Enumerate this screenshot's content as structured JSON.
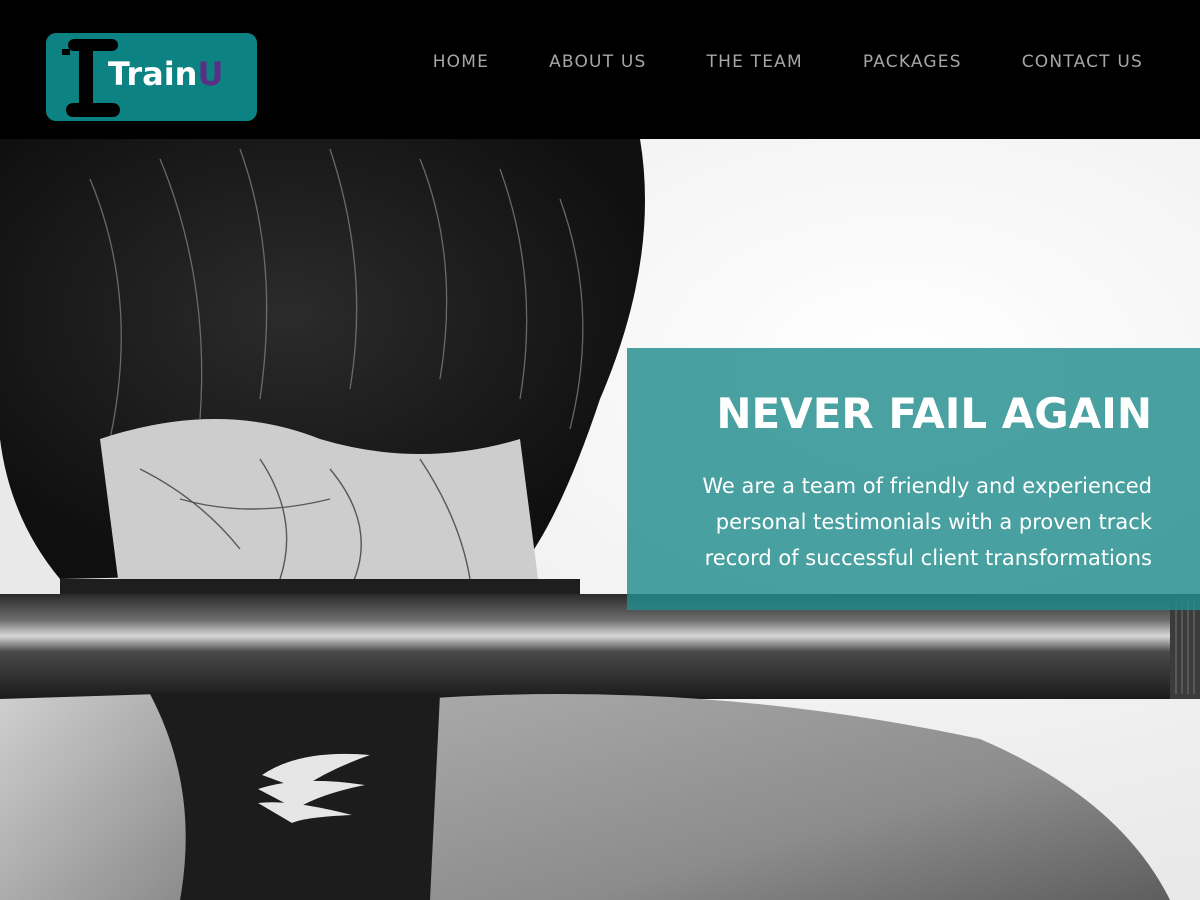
{
  "brand": {
    "name_main": "Train",
    "name_accent": "U",
    "logo_bg_color": "#0d8282",
    "accent_color": "#5a2f86",
    "icon": "dumbbell-icon"
  },
  "nav": {
    "items": [
      {
        "label": "HOME"
      },
      {
        "label": "ABOUT US"
      },
      {
        "label": "THE TEAM"
      },
      {
        "label": "PACKAGES"
      },
      {
        "label": "CONTACT US"
      }
    ]
  },
  "hero": {
    "title": "NEVER FAIL AGAIN",
    "subtitle_lines": [
      "We are a team of friendly and experienced",
      "personal testimonials with a proven track",
      "record of successful client transformations"
    ],
    "panel_color": "#228c8c",
    "image": "grayscale-photo-woman-barbell-on-shoulders"
  }
}
